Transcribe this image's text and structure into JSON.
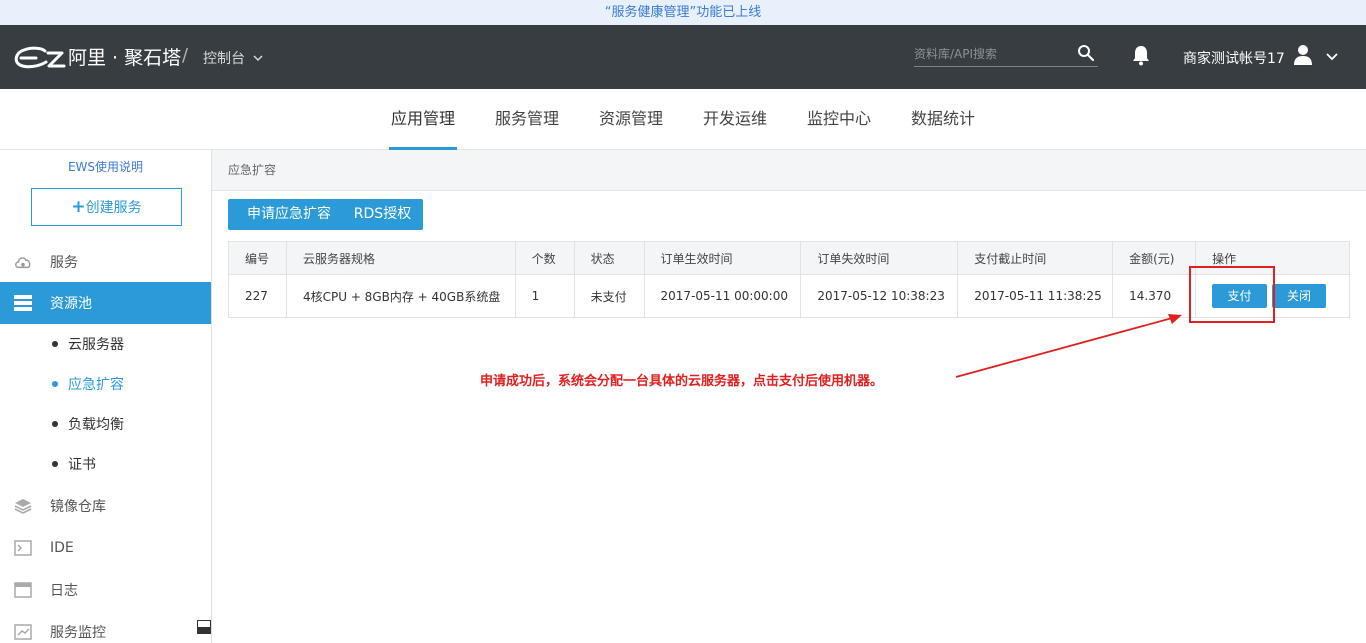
{
  "notice": {
    "text": "“服务健康管理”功能已上线"
  },
  "topbar": {
    "brand": "阿里 · 聚石塔",
    "separator": "/",
    "console_label": "控制台",
    "search_placeholder": "资料库/API搜索",
    "account_name": "商家测试帐号17",
    "bg_color": "#373d41"
  },
  "mainnav": {
    "tabs": [
      {
        "label": "应用管理",
        "active": true
      },
      {
        "label": "服务管理",
        "active": false
      },
      {
        "label": "资源管理",
        "active": false
      },
      {
        "label": "开发运维",
        "active": false
      },
      {
        "label": "监控中心",
        "active": false
      },
      {
        "label": "数据统计",
        "active": false
      }
    ],
    "accent_color": "#2c9ad7"
  },
  "sidebar": {
    "help_link": "EWS使用说明",
    "create_button": "创建服务",
    "items": [
      {
        "label": "服务",
        "icon": "cloud-icon"
      },
      {
        "label": "资源池",
        "icon": "server-stack-icon",
        "active": true
      },
      {
        "label": "镜像仓库",
        "icon": "layers-icon"
      },
      {
        "label": "IDE",
        "icon": "terminal-icon"
      },
      {
        "label": "日志",
        "icon": "log-icon"
      },
      {
        "label": "服务监控",
        "icon": "monitor-icon"
      }
    ],
    "subitems": [
      {
        "label": "云服务器",
        "active": false
      },
      {
        "label": "应急扩容",
        "active": true
      },
      {
        "label": "负载均衡",
        "active": false
      },
      {
        "label": "证书",
        "active": false
      }
    ]
  },
  "main": {
    "breadcrumb": "应急扩容",
    "buttons": {
      "apply": "申请应急扩容",
      "rds": "RDS授权"
    },
    "table": {
      "headers": [
        "编号",
        "云服务器规格",
        "个数",
        "状态",
        "订单生效时间",
        "订单失效时间",
        "支付截止时间",
        "金额(元)",
        "操作"
      ],
      "rows": [
        {
          "id": "227",
          "spec": "4核CPU + 8GB内存 + 40GB系统盘",
          "count": "1",
          "status": "未支付",
          "start": "2017-05-11 00:00:00",
          "end": "2017-05-12 10:38:23",
          "deadline": "2017-05-11 11:38:25",
          "amount": "14.370",
          "pay_label": "支付",
          "close_label": "关闭"
        }
      ]
    }
  },
  "annotation": {
    "text": "申请成功后，系统会分配一台具体的云服务器，点击支付后使用机器。",
    "color": "#e02020"
  }
}
